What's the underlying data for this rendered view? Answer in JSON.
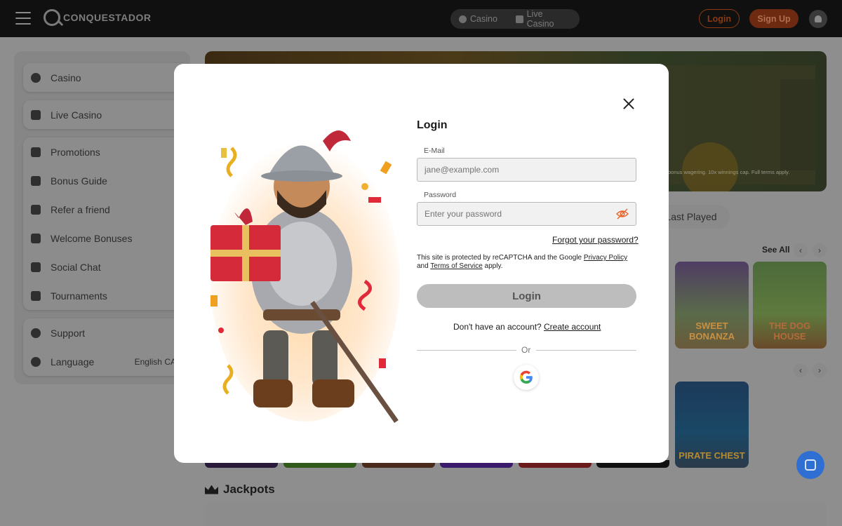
{
  "header": {
    "logo_text": "CONQUESTADOR",
    "tabs": [
      {
        "label": "Casino",
        "icon": "casino-chip-icon"
      },
      {
        "label": "Live Casino",
        "icon": "cards-icon"
      }
    ],
    "login_label": "Login",
    "signup_label": "Sign Up"
  },
  "sidebar": {
    "group1": [
      {
        "label": "Casino",
        "icon": "casino-chip-icon"
      }
    ],
    "group2": [
      {
        "label": "Live Casino",
        "icon": "cards-icon"
      }
    ],
    "group3": [
      {
        "label": "Promotions",
        "icon": "star-icon"
      },
      {
        "label": "Bonus Guide",
        "icon": "gift-icon"
      },
      {
        "label": "Refer a friend",
        "icon": "megaphone-icon"
      },
      {
        "label": "Welcome Bonuses",
        "icon": "gift-icon"
      },
      {
        "label": "Social Chat",
        "icon": "chat-icon"
      },
      {
        "label": "Tournaments",
        "icon": "trophy-icon"
      }
    ],
    "group4": [
      {
        "label": "Support",
        "icon": "support-icon"
      },
      {
        "label": "Language",
        "icon": "globe-icon",
        "value": "English CA"
      }
    ]
  },
  "background": {
    "hero_terms": "bonus wagering. 10x winnings cap. Full terms apply.",
    "last_played": "Last Played",
    "see_all": "See All",
    "games_row1": [
      "SWEET BONANZA",
      "THE DOG HOUSE"
    ],
    "games_row2": [
      "PIRATE CHEST"
    ],
    "jackpots_title": "Jackpots"
  },
  "modal": {
    "title": "Login",
    "email_label": "E-Mail",
    "email_placeholder": "jane@example.com",
    "password_label": "Password",
    "password_placeholder": "Enter your password",
    "forgot_link": "Forgot your password?",
    "recaptcha_prefix": "This site is protected by reCAPTCHA and the Google",
    "privacy_link": "Privacy Policy",
    "recaptcha_and": "and",
    "terms_link": "Terms of Service",
    "recaptcha_suffix": "apply.",
    "login_button": "Login",
    "no_account_text": "Don't have an account?",
    "create_account_link": "Create account",
    "or_text": "Or"
  },
  "colors": {
    "accent": "#e8642c",
    "login_button_bg": "#bdbdbd",
    "chat_bubble": "#2f6fd4"
  }
}
